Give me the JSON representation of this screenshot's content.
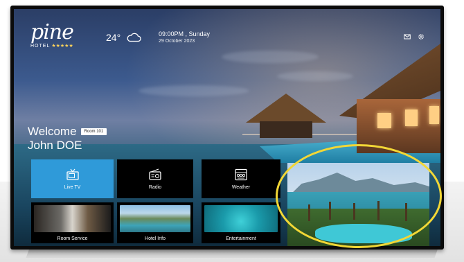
{
  "header": {
    "logo_script": "pine",
    "logo_sub": "HOTEL",
    "logo_stars": "★★★★★",
    "temperature": "24°",
    "weather_icon": "cloud-icon",
    "time": "09:00PM , Sunday",
    "date": "29 October 2023",
    "icons": [
      "mail-icon",
      "settings-icon"
    ]
  },
  "welcome": {
    "greeting": "Welcome",
    "room": "Room 101",
    "guest_name": "John DOE"
  },
  "tiles": [
    {
      "label": "Live TV",
      "icon": "tv-icon",
      "active": true
    },
    {
      "label": "Radio",
      "icon": "radio-icon",
      "active": false
    },
    {
      "label": "Weather",
      "icon": "weather-icon",
      "active": false
    }
  ],
  "photo_tiles": [
    {
      "label": "Room Service"
    },
    {
      "label": "Hotel Info"
    },
    {
      "label": "Entertainment"
    }
  ],
  "colors": {
    "active_tile": "#2f9ad9",
    "highlight_ring": "#f2d736"
  }
}
